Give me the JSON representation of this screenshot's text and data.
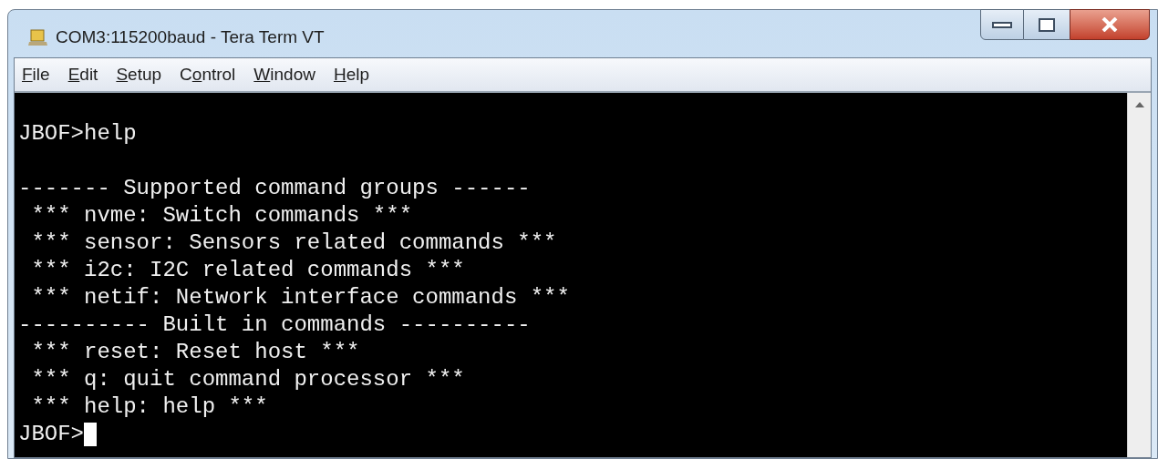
{
  "window": {
    "title": "COM3:115200baud - Tera Term VT"
  },
  "menu": [
    {
      "key": "F",
      "after": "ile"
    },
    {
      "key": "E",
      "after": "dit"
    },
    {
      "key": "S",
      "after": "etup"
    },
    {
      "before": "C",
      "key": "o",
      "after": "ntrol"
    },
    {
      "key": "W",
      "after": "indow"
    },
    {
      "key": "H",
      "after": "elp"
    }
  ],
  "terminal": {
    "lines": [
      {
        "kind": "blank"
      },
      {
        "kind": "text",
        "text": "JBOF>help"
      },
      {
        "kind": "blank"
      },
      {
        "kind": "text",
        "text": "------- Supported command groups ------"
      },
      {
        "kind": "text",
        "text": " *** nvme: Switch commands ***"
      },
      {
        "kind": "text",
        "text": " *** sensor: Sensors related commands ***"
      },
      {
        "kind": "text",
        "text": " *** i2c: I2C related commands ***"
      },
      {
        "kind": "text",
        "text": " *** netif: Network interface commands ***"
      },
      {
        "kind": "text",
        "text": "---------- Built in commands ----------"
      },
      {
        "kind": "text",
        "text": " *** reset: Reset host ***"
      },
      {
        "kind": "text",
        "text": " *** q: quit command processor ***"
      },
      {
        "kind": "text",
        "text": " *** help: help ***"
      },
      {
        "kind": "prompt",
        "text": "JBOF>",
        "cursor": true
      }
    ]
  }
}
